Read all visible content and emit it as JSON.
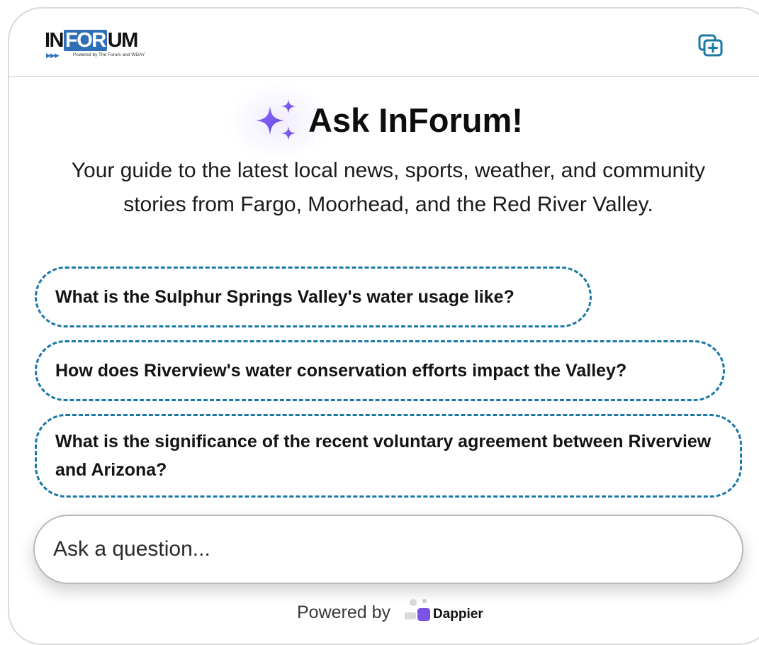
{
  "header": {
    "logo": {
      "word_in": "IN",
      "word_for": "FOR",
      "word_um": "UM",
      "arrows": "▶▶▶",
      "tagline": "Powered by The Forum and WDAY"
    },
    "new_chat_icon": "new-chat-icon"
  },
  "hero": {
    "icon": "sparkles-icon",
    "title": "Ask InForum!",
    "subtitle": "Your guide to the latest local news, sports, weather, and community stories from Fargo, Moorhead, and the Red River Valley."
  },
  "suggestions": [
    "What is the Sulphur Springs Valley's water usage like?",
    "How does Riverview's water conservation efforts impact the Valley?",
    "What is the significance of the recent voluntary agreement between Riverview and Arizona?"
  ],
  "input": {
    "placeholder": "Ask a question..."
  },
  "footer": {
    "powered_by": "Powered by",
    "brand": "Dappier"
  },
  "colors": {
    "accent": "#1a78a5",
    "logo_blue": "#2f6fb8",
    "sparkle_purple": "#7b54e6"
  }
}
